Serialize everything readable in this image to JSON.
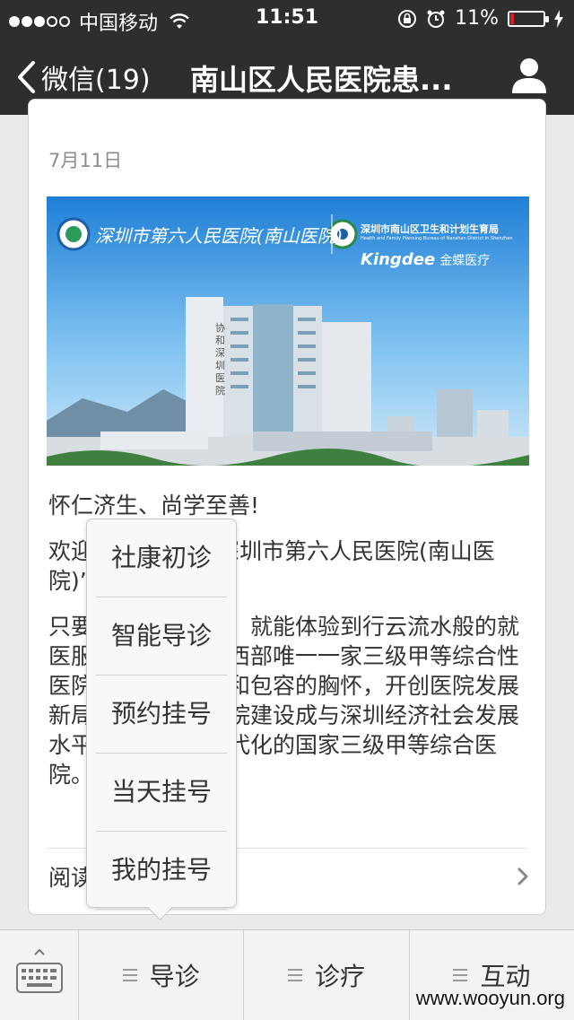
{
  "status_bar": {
    "carrier": "中国移动",
    "time": "11:51",
    "battery": "11%",
    "battery_level": 0.11
  },
  "nav": {
    "back_label": "微信(19)",
    "title": "南山区人民医院患..."
  },
  "article": {
    "date": "7月11日",
    "banner": {
      "hospital_name": "深圳市第六人民医院(南山医院)",
      "bureau_name": "深圳市南山区卫生和计划生育局",
      "bureau_en": "Health and Family Planning Bureau of Nanshan District in Shenzhen",
      "partner_latin": "Kingdee",
      "partner_cn": "金蝶医疗",
      "building_sign": "协和深圳医院"
    },
    "paragraphs": [
      "怀仁济生、尚学至善!",
      "欢迎关注我们的“深圳市第六人民医院(南山医院)”",
      "只要轻轻一点控我，就能体验到行云流水般的就医服务。做为深圳西部唯一一家三级甲等综合性医院，我们以开放和包容的胸怀，开创医院发展新局面，努力将医院建设成与深圳经济社会发展水平相适应的、现代化的国家三级甲等综合医院。"
    ],
    "read_all": "阅读全文"
  },
  "popup_menu": {
    "items": [
      "社康初诊",
      "智能导诊",
      "预约挂号",
      "当天挂号",
      "我的挂号"
    ]
  },
  "menu_bar": {
    "tabs": [
      "导诊",
      "诊疗",
      "互动"
    ]
  },
  "watermark": "www.wooyun.org"
}
